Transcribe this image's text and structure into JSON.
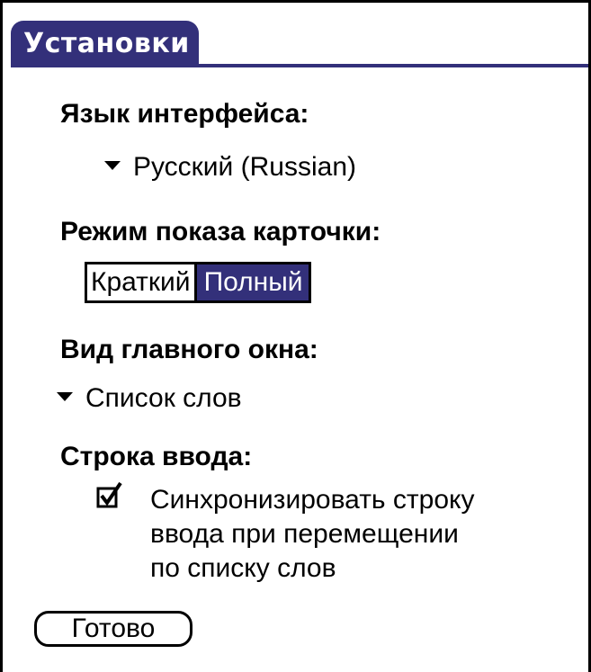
{
  "window": {
    "title": "Установки"
  },
  "colors": {
    "accent": "#33307a",
    "background": "#ffffff",
    "text": "#000000"
  },
  "interface_language": {
    "label": "Язык интерфейса:",
    "selected": "Русский (Russian)"
  },
  "card_mode": {
    "label": "Режим показа карточки:",
    "options": [
      "Краткий",
      "Полный"
    ],
    "selected": "Полный"
  },
  "main_window_view": {
    "label": "Вид главного окна:",
    "selected": "Список слов"
  },
  "input_line": {
    "label": "Строка ввода:",
    "sync_checkbox": {
      "checked": true,
      "text_lines": [
        "Синхронизировать строку",
        "ввода при перемещении",
        "по списку слов"
      ]
    }
  },
  "buttons": {
    "done_label": "Готово"
  },
  "icons": {
    "dropdown": "triangle-down-icon",
    "checkbox": "checkbox-checked-icon"
  }
}
